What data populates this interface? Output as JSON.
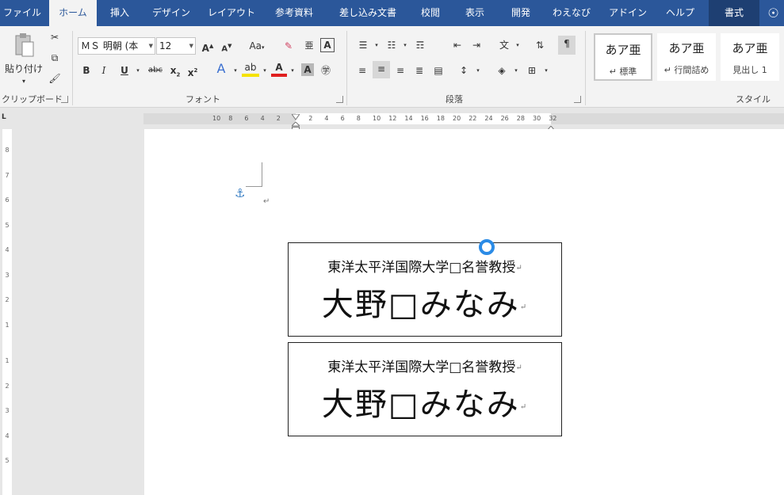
{
  "tabs": [
    {
      "label": "ファイル",
      "state": "normal"
    },
    {
      "label": "ホーム",
      "state": "active"
    },
    {
      "label": "挿入",
      "state": "normal"
    },
    {
      "label": "デザイン",
      "state": "normal"
    },
    {
      "label": "レイアウト",
      "state": "normal"
    },
    {
      "label": "参考資料",
      "state": "normal"
    },
    {
      "label": "差し込み文書",
      "state": "normal"
    },
    {
      "label": "校閲",
      "state": "normal"
    },
    {
      "label": "表示",
      "state": "normal"
    },
    {
      "label": "開発",
      "state": "normal"
    },
    {
      "label": "わえなび",
      "state": "normal"
    },
    {
      "label": "アドイン",
      "state": "normal"
    },
    {
      "label": "ヘルプ",
      "state": "normal"
    },
    {
      "label": "書式",
      "state": "contextual"
    }
  ],
  "clipboard": {
    "paste_label": "貼り付け",
    "group_label": "クリップボード"
  },
  "font": {
    "name": "ＭＳ 明朝 (本",
    "size": "12",
    "change_case": "Aa",
    "group_label": "フォント"
  },
  "paragraph": {
    "group_label": "段落"
  },
  "styles": {
    "group_label": "スタイル",
    "items": [
      {
        "sample": "あア亜",
        "name": "↵ 標準"
      },
      {
        "sample": "あア亜",
        "name": "↵ 行間詰め"
      },
      {
        "sample": "あア亜",
        "name": "見出し 1"
      }
    ]
  },
  "ruler": {
    "h_labels_left": [
      "10",
      "8",
      "6",
      "4",
      "2"
    ],
    "h_labels_right": [
      "2",
      "4",
      "6",
      "8",
      "10",
      "12",
      "14",
      "16",
      "18",
      "20",
      "22",
      "24",
      "26",
      "28",
      "30",
      "32"
    ],
    "v_labels": [
      "8",
      "7",
      "6",
      "5",
      "4",
      "3",
      "2",
      "1",
      "1",
      "2",
      "3",
      "4",
      "5"
    ]
  },
  "document": {
    "textboxes": [
      {
        "line1": "東洋太平洋国際大学□名誉教授",
        "line2": "大野□みなみ"
      },
      {
        "line1": "東洋太平洋国際大学□名誉教授",
        "line2": "大野□みなみ"
      }
    ],
    "return_mark": "↵"
  },
  "colors": {
    "tab_bar": "#2b579a",
    "ribbon": "#f3f3f3",
    "page": "#ffffff",
    "rotate_handle": "#2b8be6",
    "anchor": "#3a7fc4"
  }
}
